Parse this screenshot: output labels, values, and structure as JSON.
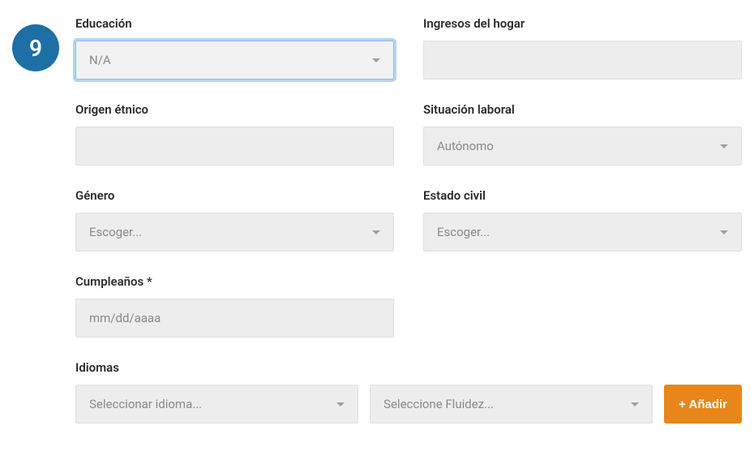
{
  "step": "9",
  "fields": {
    "education": {
      "label": "Educación",
      "value": "N/A"
    },
    "income": {
      "label": "Ingresos del hogar",
      "value": ""
    },
    "ethnic": {
      "label": "Origen étnico",
      "value": ""
    },
    "employment": {
      "label": "Situación laboral",
      "value": "Autónomo"
    },
    "gender": {
      "label": "Género",
      "value": "Escoger..."
    },
    "marital": {
      "label": "Estado civil",
      "value": "Escoger..."
    },
    "birthday": {
      "label": "Cumpleaños *",
      "placeholder": "mm/dd/aaaa"
    },
    "languages": {
      "label": "Idiomas",
      "lang_placeholder": "Seleccionar idioma...",
      "fluency_placeholder": "Seleccione Fluidez...",
      "add_label": "+ Añadir"
    }
  }
}
